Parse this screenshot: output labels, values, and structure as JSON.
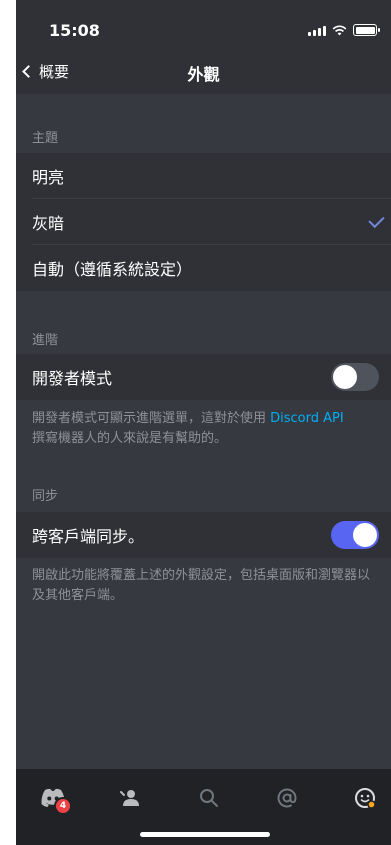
{
  "status": {
    "time": "15:08"
  },
  "nav": {
    "back_label": "概要",
    "title": "外觀"
  },
  "theme": {
    "header": "主題",
    "options": [
      {
        "label": "明亮",
        "selected": false
      },
      {
        "label": "灰暗",
        "selected": true
      },
      {
        "label": "自動（遵循系統設定）",
        "selected": false
      }
    ]
  },
  "advanced": {
    "header": "進階",
    "developer_mode": {
      "label": "開發者模式",
      "enabled": false
    },
    "description_main": "開發者模式可顯示進階選單，這對於使用 ",
    "description_link": "Discord API",
    "description_rest": "撰寫機器人的人來說是有幫助的。"
  },
  "sync": {
    "header": "同步",
    "cross_client": {
      "label": "跨客戶端同步。",
      "enabled": true
    },
    "description": "開啟此功能將覆蓋上述的外觀設定，包括桌面版和瀏覽器以及其他客戶端。"
  },
  "tabbar": {
    "badge_count": "4",
    "tabs": [
      {
        "name": "home",
        "icon": "discord-logo-icon"
      },
      {
        "name": "friends",
        "icon": "friends-wave-icon"
      },
      {
        "name": "search",
        "icon": "search-icon"
      },
      {
        "name": "mentions",
        "icon": "at-mention-icon"
      },
      {
        "name": "profile",
        "icon": "profile-avatar-icon"
      }
    ]
  },
  "colors": {
    "background": "#36393f",
    "row": "#2f3136",
    "tabbar": "#202225",
    "accent": "#5865f2",
    "link": "#00aff4",
    "muted_text": "#8e9297"
  }
}
